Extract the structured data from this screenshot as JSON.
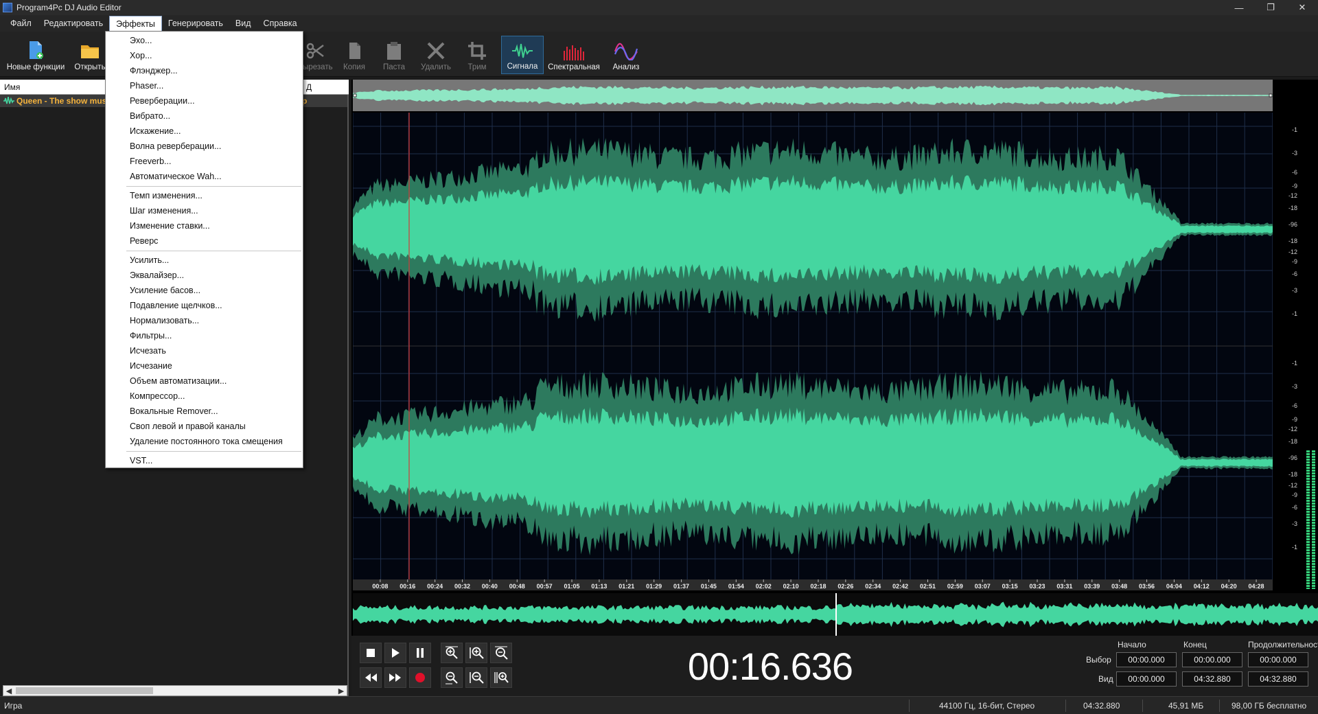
{
  "window": {
    "title": "Program4Pc DJ Audio Editor",
    "controls": [
      "—",
      "❐",
      "✕"
    ]
  },
  "menubar": [
    "Файл",
    "Редактировать",
    "Эффекты",
    "Генерировать",
    "Вид",
    "Справка"
  ],
  "active_menu": "Эффекты",
  "toolbar": {
    "new_features": "Новые функции",
    "open": "Открыть",
    "cut": "Вырезать",
    "copy": "Копия",
    "paste": "Паста",
    "delete": "Удалить",
    "trim": "Трим",
    "signal": "Сигнала",
    "spectral": "Спектральная",
    "analysis": "Анализ"
  },
  "file_list": {
    "header_name": "Имя",
    "header_col2": "Д",
    "file_name": "Queen - The show must go on",
    "file_col2": "р"
  },
  "effects_menu": {
    "group1": [
      "Эхо...",
      "Хор...",
      "Флэнджер...",
      "Phaser...",
      "Реверберации...",
      "Вибрато...",
      "Искажение...",
      "Волна реверберации...",
      "Freeverb...",
      "Автоматическое Wah..."
    ],
    "group2": [
      "Темп изменения...",
      "Шаг изменения...",
      "Изменение ставки...",
      "Реверс"
    ],
    "group3": [
      "Усилить...",
      "Эквалайзер...",
      "Усиление басов...",
      "Подавление щелчков...",
      "Нормализовать...",
      "Фильтры...",
      "Исчезать",
      "Исчезание",
      "Объем автоматизации...",
      "Компрессор...",
      "Вокальные Remover...",
      "Своп левой и правой каналы",
      "Удаление постоянного тока смещения"
    ],
    "group4": [
      "VST..."
    ]
  },
  "db_scale_top": [
    "-1",
    "-3",
    "-6",
    "-9",
    "-12",
    "-18",
    "-96",
    "-18",
    "-12",
    "-9",
    "-6",
    "-3",
    "-1"
  ],
  "timeline_labels": [
    "00:08",
    "00:16",
    "00:24",
    "00:32",
    "00:40",
    "00:48",
    "00:57",
    "01:05",
    "01:13",
    "01:21",
    "01:29",
    "01:37",
    "01:45",
    "01:54",
    "02:02",
    "02:10",
    "02:18",
    "02:26",
    "02:34",
    "02:42",
    "02:51",
    "02:59",
    "03:07",
    "03:15",
    "03:23",
    "03:31",
    "03:39",
    "03:48",
    "03:56",
    "04:04",
    "04:12",
    "04:20",
    "04:28"
  ],
  "transport": {
    "time": "00:16.636",
    "labels": {
      "start": "Начало",
      "end": "Конец",
      "duration": "Продолжительность",
      "selection": "Выбор",
      "view": "Вид"
    },
    "selection": {
      "start": "00:00.000",
      "end": "00:00.000",
      "duration": "00:00.000"
    },
    "view": {
      "start": "00:00.000",
      "end": "04:32.880",
      "duration": "04:32.880"
    }
  },
  "statusbar": {
    "state": "Игра",
    "format": "44100 Гц, 16-бит, Стерео",
    "length": "04:32.880",
    "size": "45,91 МБ",
    "free": "98,00 ГБ бесплатно"
  },
  "colors": {
    "wave": "#45d6a0",
    "wave_dark": "#2d7a5e",
    "grid": "#1f2e4a",
    "playhead": "#d33a3a",
    "selected_tool": "#1f3b55"
  }
}
